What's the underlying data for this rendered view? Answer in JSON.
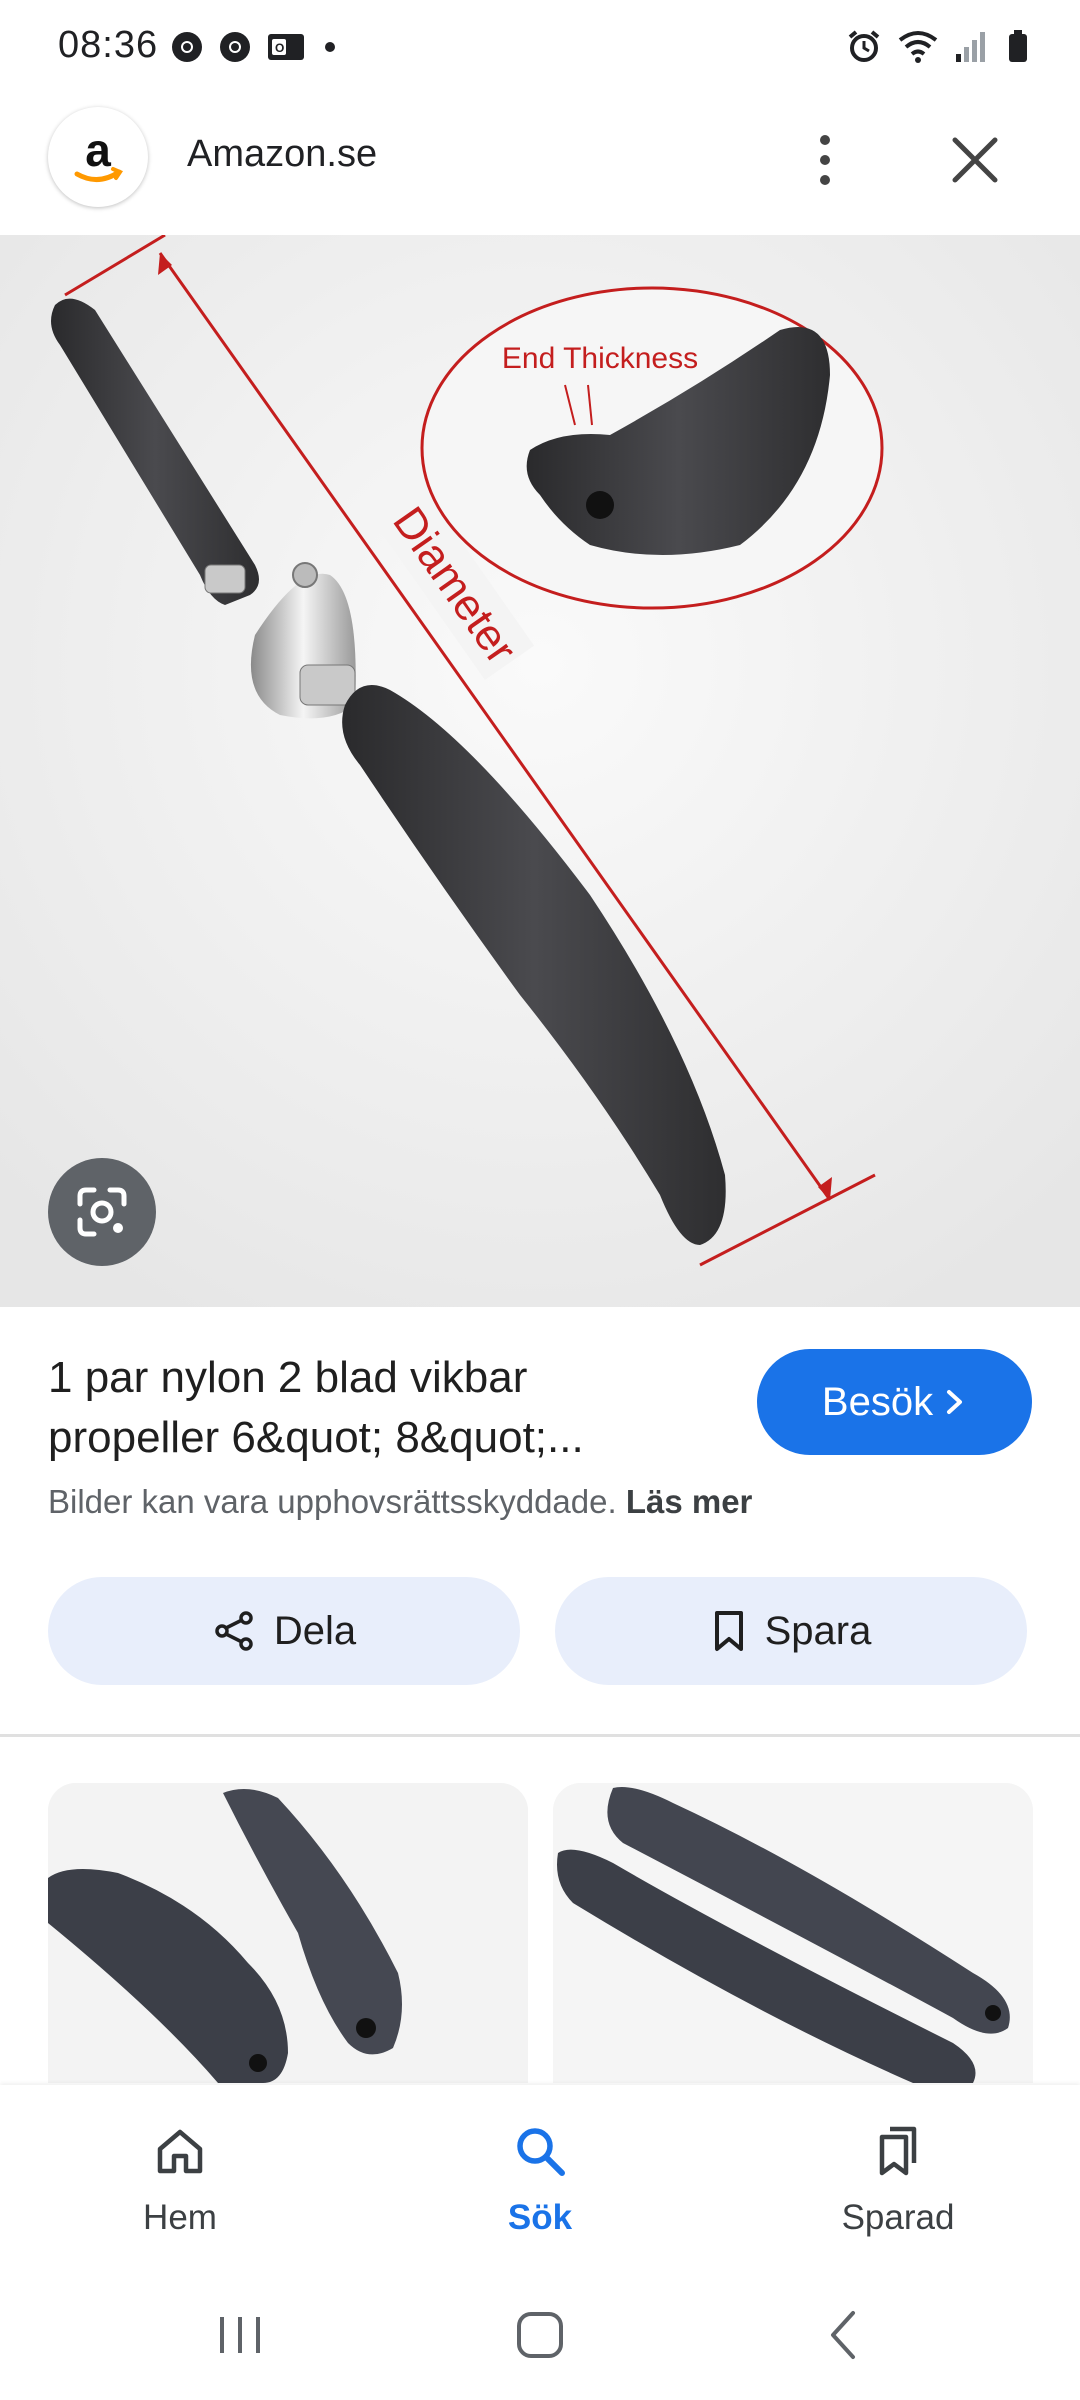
{
  "status_bar": {
    "time": "08:36",
    "left_icons": [
      "chrome-icon",
      "chrome-icon",
      "outlook-icon",
      "dot-icon"
    ],
    "right_icons": [
      "alarm-icon",
      "wifi-icon",
      "signal-icon",
      "battery-icon"
    ]
  },
  "header": {
    "site_name": "Amazon.se",
    "favicon": "amazon-logo",
    "favicon_letter": "a"
  },
  "image": {
    "label_end_thickness": "End Thickness",
    "label_diameter": "Diameter"
  },
  "result": {
    "title": "1 par nylon 2 blad vikbar propeller 6&quot; 8&quot;...",
    "visit_label": "Besök",
    "copyright_text": "Bilder kan vara upphovsrättsskyddade.",
    "read_more": "Läs mer"
  },
  "actions": {
    "share_label": "Dela",
    "save_label": "Spara"
  },
  "bottom_nav": {
    "home": "Hem",
    "search": "Sök",
    "saved": "Sparad"
  },
  "colors": {
    "accent": "#1a73e8",
    "chip_bg": "#e8eefb",
    "annotation_red": "#c41e1e"
  }
}
